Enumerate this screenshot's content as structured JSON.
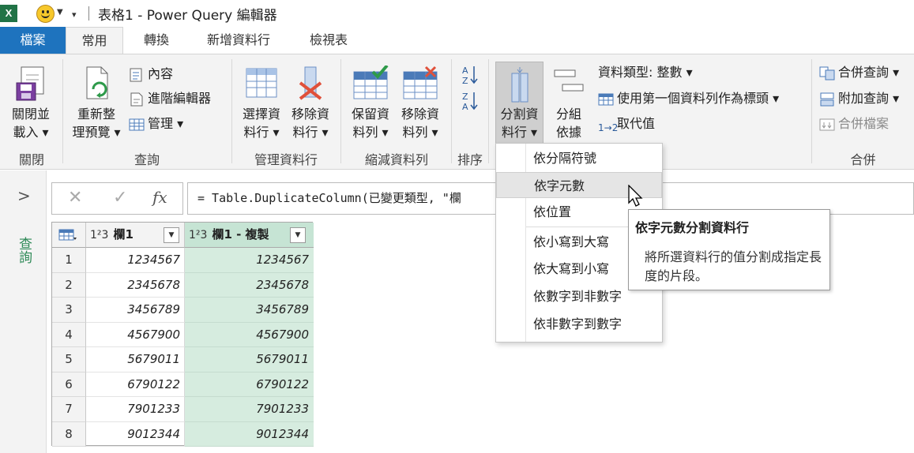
{
  "app": {
    "icon_letter": "X",
    "title": "表格1 - Power Query 編輯器"
  },
  "tabs": [
    {
      "label": "檔案"
    },
    {
      "label": "常用"
    },
    {
      "label": "轉換"
    },
    {
      "label": "新增資料行"
    },
    {
      "label": "檢視表"
    }
  ],
  "ribbon": {
    "close": {
      "btn1": "關閉並",
      "btn2": "載入 ▾",
      "group": "關閉"
    },
    "query": {
      "refresh1": "重新整",
      "refresh2": "理預覽 ▾",
      "properties": "內容",
      "advanced_editor": "進階編輯器",
      "manage": "管理 ▾",
      "group": "查詢"
    },
    "manage_cols": {
      "choose1": "選擇資",
      "choose2": "料行 ▾",
      "remove1": "移除資",
      "remove2": "料行 ▾",
      "group": "管理資料行"
    },
    "reduce_rows": {
      "keep1": "保留資",
      "keep2": "料列 ▾",
      "remove1": "移除資",
      "remove2": "料列 ▾",
      "group": "縮減資料列"
    },
    "sort": {
      "group": "排序"
    },
    "transform": {
      "split1": "分割資",
      "split2": "料行 ▾",
      "group1": "分組",
      "group2": "依據",
      "datatype": "資料類型: 整數 ▾",
      "first_row_header": "使用第一個資料列作為標頭 ▾",
      "replace_values": "取代值"
    },
    "combine": {
      "merge": "合併查詢 ▾",
      "append": "附加查詢 ▾",
      "combine_files": "合併檔案",
      "group": "合併"
    }
  },
  "sidebar": {
    "label": "查詢"
  },
  "formula_bar": {
    "cancel": "✕",
    "commit": "✓",
    "fx": "fx",
    "formula": "= Table.DuplicateColumn(已變更類型, \"欄"
  },
  "table": {
    "columns": [
      {
        "type_icon": "1²3",
        "name": "欄1"
      },
      {
        "type_icon": "1²3",
        "name": "欄1 - 複製"
      }
    ],
    "rows": [
      {
        "n": "1",
        "a": "1234567",
        "b": "1234567"
      },
      {
        "n": "2",
        "a": "2345678",
        "b": "2345678"
      },
      {
        "n": "3",
        "a": "3456789",
        "b": "3456789"
      },
      {
        "n": "4",
        "a": "4567900",
        "b": "4567900"
      },
      {
        "n": "5",
        "a": "5679011",
        "b": "5679011"
      },
      {
        "n": "6",
        "a": "6790122",
        "b": "6790122"
      },
      {
        "n": "7",
        "a": "7901233",
        "b": "7901233"
      },
      {
        "n": "8",
        "a": "9012344",
        "b": "9012344"
      }
    ]
  },
  "split_menu": {
    "items": [
      "依分隔符號",
      "依字元數",
      "依位置",
      "依小寫到大寫",
      "依大寫到小寫",
      "依數字到非數字",
      "依非數字到數字"
    ],
    "highlighted": "依字元數"
  },
  "tooltip": {
    "title": "依字元數分割資料行",
    "body": "將所選資料行的值分割成指定長度的片段。"
  },
  "colors": {
    "accent": "#1e73be",
    "selected_column": "#d6ecdf",
    "header_selected": "#c6e4d4",
    "query_label": "#2e8a57"
  }
}
